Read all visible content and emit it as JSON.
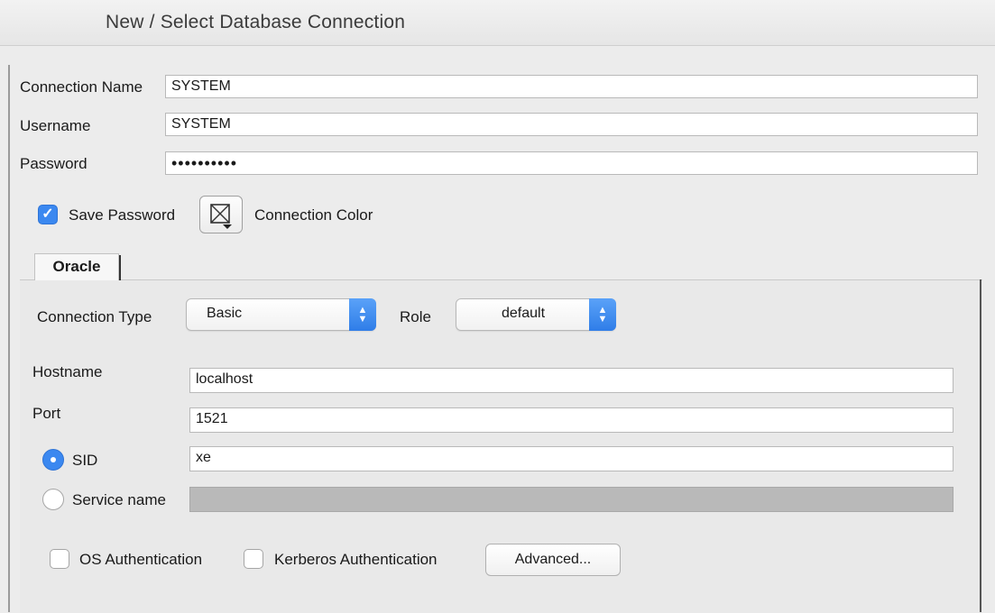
{
  "window": {
    "title": "New / Select Database Connection"
  },
  "form": {
    "connection_name_label": "Connection Name",
    "connection_name_value": "SYSTEM",
    "username_label": "Username",
    "username_value": "SYSTEM",
    "password_label": "Password",
    "password_value": "••••••••••",
    "save_password_label": "Save Password",
    "save_password_checked": true,
    "connection_color_label": "Connection Color"
  },
  "tabs": [
    {
      "label": "Oracle",
      "active": true
    }
  ],
  "oracle": {
    "connection_type_label": "Connection Type",
    "connection_type_value": "Basic",
    "role_label": "Role",
    "role_value": "default",
    "hostname_label": "Hostname",
    "hostname_value": "localhost",
    "port_label": "Port",
    "port_value": "1521",
    "sid_label": "SID",
    "sid_value": "xe",
    "sid_selected": true,
    "service_name_label": "Service name",
    "service_name_value": "",
    "os_auth_label": "OS Authentication",
    "os_auth_checked": false,
    "kerberos_auth_label": "Kerberos Authentication",
    "kerberos_auth_checked": false,
    "advanced_label": "Advanced..."
  },
  "icons": {
    "checkmark": "checkmark-icon",
    "connection_color": "color-picker-icon",
    "select_arrows": "updown-chevron-icon"
  },
  "colors": {
    "accent": "#3b88f0",
    "disabled_field": "#b9b9b9"
  }
}
